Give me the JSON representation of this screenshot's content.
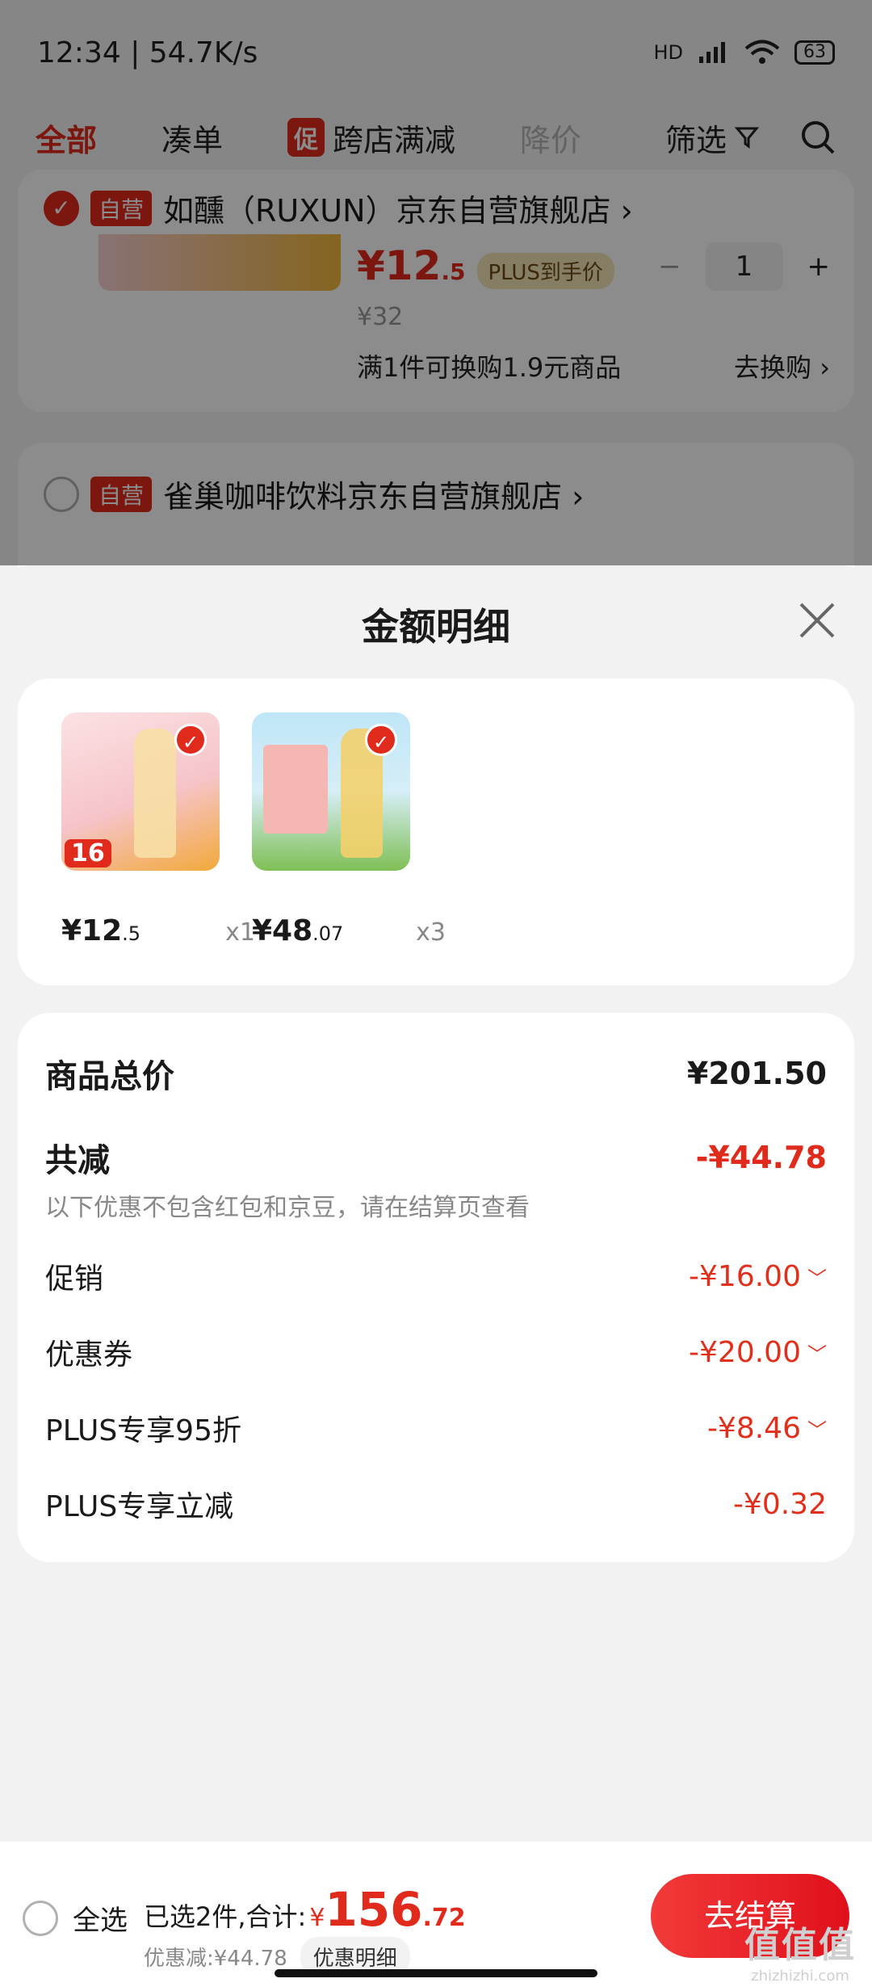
{
  "status": {
    "time": "12:34 | 54.7K/s",
    "network": "HD",
    "battery": "63"
  },
  "filters": {
    "all": "全部",
    "combine": "凑单",
    "promo_badge": "促",
    "promo": "跨店满减",
    "price_drop": "降价",
    "screen": "筛选"
  },
  "store1": {
    "tag": "自营",
    "name": "如醺（RUXUN）京东自营旗舰店 ›",
    "price_int": "¥12",
    "price_dec": ".5",
    "plus_tag": "PLUS到手价",
    "orig_price": "¥32",
    "qty": "1",
    "swap_text": "满1件可换购1.9元商品",
    "swap_link": "去换购 ›"
  },
  "store2": {
    "tag": "自营",
    "name": "雀巢咖啡饮料京东自营旗舰店 ›"
  },
  "sheet": {
    "title": "金额明细",
    "goods": [
      {
        "price_int": "¥12",
        "price_dec": ".5",
        "qty": "x1",
        "badge": "16"
      },
      {
        "price_int": "¥48",
        "price_dec": ".07",
        "qty": "x3"
      }
    ],
    "detail": {
      "total_label": "商品总价",
      "total_value": "¥201.50",
      "reduce_label": "共减",
      "reduce_value": "-¥44.78",
      "note": "以下优惠不包含红包和京豆，请在结算页查看",
      "rows": [
        {
          "label": "促销",
          "value": "-¥16.00"
        },
        {
          "label": "优惠券",
          "value": "-¥20.00"
        },
        {
          "label": "PLUS专享95折",
          "value": "-¥8.46"
        },
        {
          "label": "PLUS专享立减",
          "value": "-¥0.32"
        }
      ]
    }
  },
  "bottom": {
    "select_all": "全选",
    "summary": "已选2件,合计:",
    "currency": "¥",
    "total_int": "156",
    "total_dec": ".72",
    "discount": "优惠减:¥44.78",
    "discount_link": "优惠明细",
    "checkout": "去结算"
  },
  "watermark": {
    "logo": "值值值",
    "site": "zhizhizhi.com"
  }
}
